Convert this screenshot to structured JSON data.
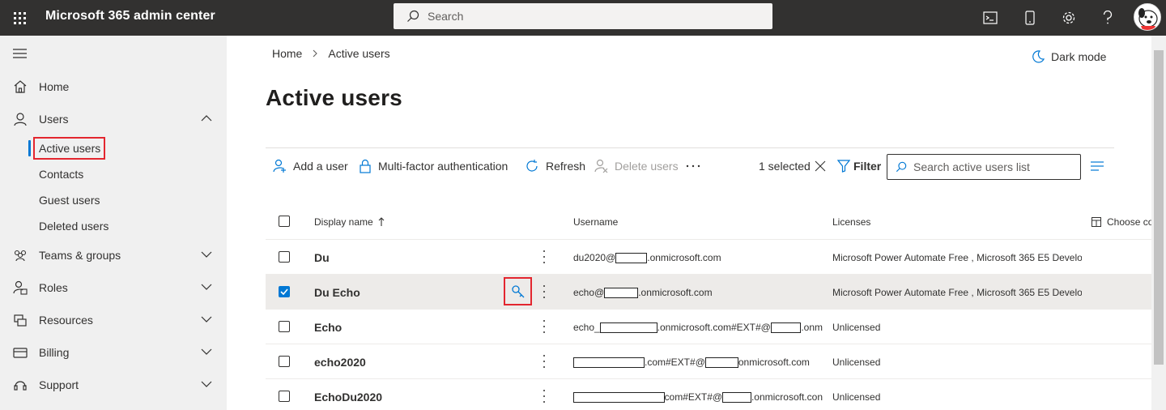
{
  "app": {
    "title": "Microsoft 365 admin center"
  },
  "search": {
    "placeholder": "Search"
  },
  "topbar": {
    "icons": [
      "terminal-icon",
      "mobile-icon",
      "gear-icon",
      "help-icon",
      "avatar"
    ]
  },
  "sidebar": {
    "items": [
      {
        "label": "Home",
        "icon": "home-icon"
      },
      {
        "label": "Users",
        "icon": "person-icon",
        "expanded": true
      },
      {
        "label": "Teams & groups",
        "icon": "people-icon"
      },
      {
        "label": "Roles",
        "icon": "roles-icon"
      },
      {
        "label": "Resources",
        "icon": "resources-icon"
      },
      {
        "label": "Billing",
        "icon": "billing-icon"
      },
      {
        "label": "Support",
        "icon": "headset-icon"
      }
    ],
    "sub_items": [
      {
        "label": "Active users",
        "active": true
      },
      {
        "label": "Contacts"
      },
      {
        "label": "Guest users"
      },
      {
        "label": "Deleted users"
      }
    ]
  },
  "breadcrumb": {
    "home": "Home",
    "current": "Active users"
  },
  "dark_mode": "Dark mode",
  "page_title": "Active users",
  "toolbar": {
    "add_user": "Add a user",
    "mfa": "Multi-factor authentication",
    "refresh": "Refresh",
    "delete": "Delete users",
    "selected": "1 selected",
    "filter": "Filter",
    "search_placeholder": "Search active users list"
  },
  "table": {
    "headers": {
      "display_name": "Display name",
      "username": "Username",
      "licenses": "Licenses",
      "choose": "Choose co"
    },
    "rows": [
      {
        "name": "Du",
        "checked": false,
        "licenses": "Microsoft Power Automate Free , Microsoft 365 E5 Develop"
      },
      {
        "name": "Du Echo",
        "checked": true,
        "licenses": "Microsoft Power Automate Free , Microsoft 365 E5 Develop"
      },
      {
        "name": "Echo",
        "checked": false,
        "licenses": "Unlicensed"
      },
      {
        "name": "echo2020",
        "checked": false,
        "licenses": "Unlicensed"
      },
      {
        "name": "EchoDu2020",
        "checked": false,
        "licenses": "Unlicensed"
      }
    ],
    "username_parts": {
      "du_prefix": "du2020@",
      "ms_suffix": ".onmicrosoft.com",
      "echo_prefix": "echo@",
      "echo_ext_prefix": "echo_",
      "ext_mid": ".onmicrosoft.com#EXT#@",
      "ext_tail": ".onm",
      "com_ext": ".com#EXT#@",
      "onms": "onmicrosoft.com",
      "com_ext2": "com#EXT#@",
      "onms_trunc": ".onmicrosoft.con"
    }
  },
  "colors": {
    "accent": "#0078d4",
    "topbar": "#323130",
    "highlight": "#e3262f"
  }
}
